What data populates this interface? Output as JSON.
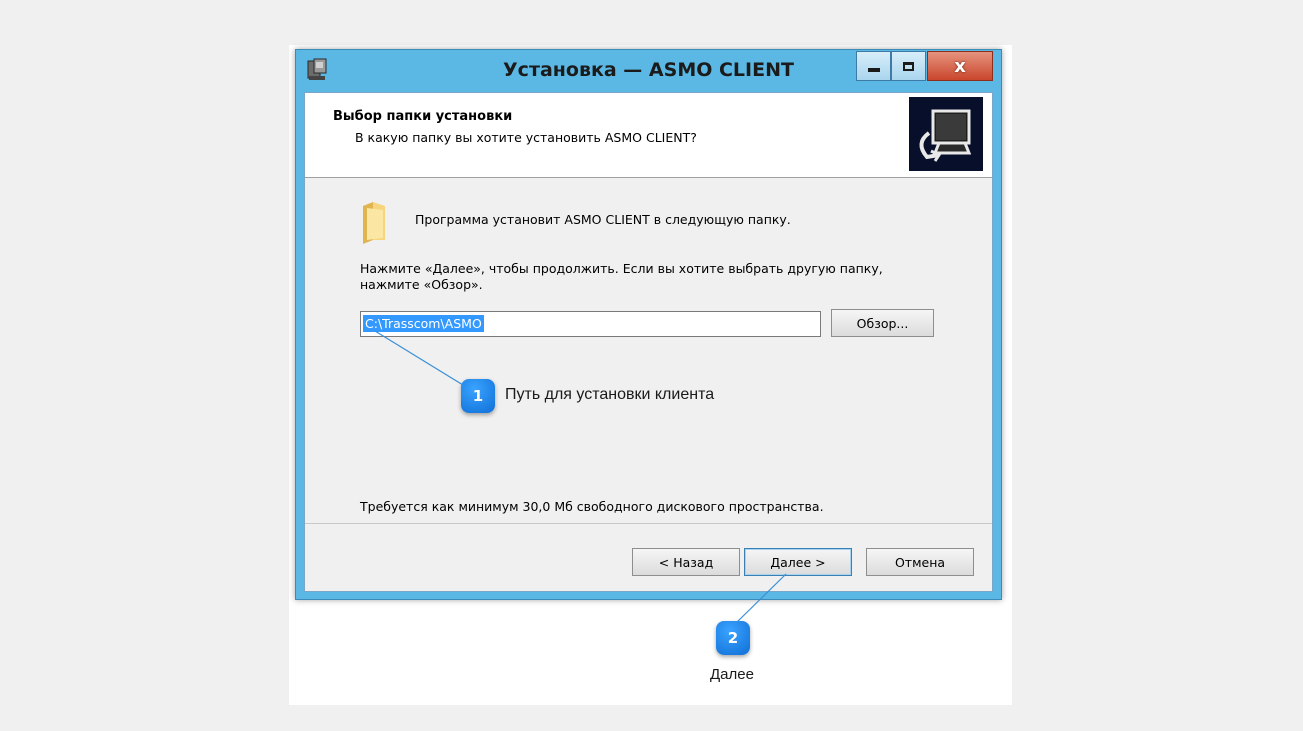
{
  "window": {
    "title": "Установка — ASMO CLIENT",
    "controls": {
      "minimize": "minimize-icon",
      "maximize": "maximize-icon",
      "close": "close-icon"
    }
  },
  "header": {
    "title": "Выбор папки установки",
    "subtitle": "В какую папку вы хотите установить ASMO CLIENT?"
  },
  "body": {
    "intro": "Программа установит ASMO CLIENT в следующую папку.",
    "instruction_line1": "Нажмите «Далее», чтобы продолжить. Если вы хотите выбрать другую папку,",
    "instruction_line2": "нажмите «Обзор».",
    "path_value": "C:\\Trasscom\\ASMO",
    "browse_label": "Обзор...",
    "disk_space": "Требуется как минимум 30,0 Мб свободного дискового пространства."
  },
  "footer": {
    "back_label": "< Назад",
    "next_label": "Далее >",
    "cancel_label": "Отмена"
  },
  "annotations": {
    "callout1_number": "1",
    "callout1_text": "Путь для установки клиента",
    "callout2_number": "2",
    "callout2_text": "Далее",
    "accent": "#1a7fe6"
  }
}
